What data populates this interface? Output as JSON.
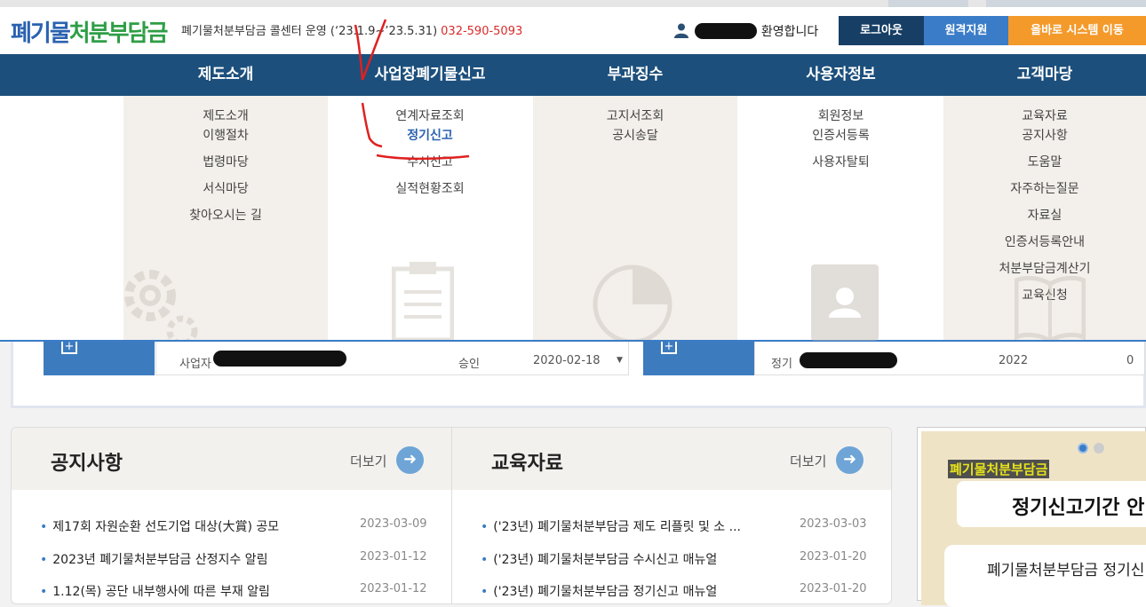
{
  "header": {
    "logo_part1": "폐기물",
    "logo_part2": "처분부담금",
    "callcenter": "폐기물처분부담금 콜센터 운영 (‘23.1.9~’23.5.31)",
    "phone": "032-590-5093",
    "welcome": "환영합니다",
    "buttons": [
      {
        "label": "로그아웃",
        "color": "#173f66"
      },
      {
        "label": "원격지원",
        "color": "#3a7cc7"
      },
      {
        "label": "올바로 시스템 이동",
        "color": "#f39a2b"
      }
    ]
  },
  "nav": {
    "items": [
      "제도소개",
      "사업장폐기물신고",
      "부과징수",
      "사용자정보",
      "고객마당"
    ]
  },
  "mega": {
    "col1": [
      "제도소개",
      "이행절차",
      "법령마당",
      "서식마당",
      "찾아오시는 길"
    ],
    "col2": [
      "연계자료조회",
      "정기신고",
      "수시신고",
      "실적현황조회"
    ],
    "col3": [
      "고지서조회",
      "공시송달"
    ],
    "col4": [
      "회원정보",
      "인증서등록",
      "사용자탈퇴"
    ],
    "col5": [
      "교육자료",
      "공지사항",
      "도움말",
      "자주하는질문",
      "자료실",
      "인증서등록안내",
      "처분부담금계산기",
      "교육신청"
    ],
    "active_item": "정기신고"
  },
  "behind": {
    "left": {
      "type": "사업자",
      "status": "승인",
      "date": "2020-02-18"
    },
    "right": {
      "type": "정기",
      "year": "2022",
      "value": "0"
    }
  },
  "boards": {
    "notice": {
      "title": "공지사항",
      "more": "더보기",
      "items": [
        {
          "title": "제17회 자원순환 선도기업 대상(大賞) 공모",
          "date": "2023-03-09"
        },
        {
          "title": "2023년 폐기물처분부담금 산정지수 알림",
          "date": "2023-01-12"
        },
        {
          "title": "1.12(목) 공단 내부행사에 따른 부재 알림",
          "date": "2023-01-12"
        }
      ]
    },
    "edu": {
      "title": "교육자료",
      "more": "더보기",
      "items": [
        {
          "title": "('23년) 폐기물처분부담금 제도 리플릿 및 소 ...",
          "date": "2023-03-03"
        },
        {
          "title": "('23년) 폐기물처분부담금 수시신고 매뉴얼",
          "date": "2023-01-20"
        },
        {
          "title": "('23년) 폐기물처분부담금 정기신고 매뉴얼",
          "date": "2023-01-20"
        }
      ]
    }
  },
  "banner": {
    "tag": "폐기물처분부담금",
    "line1": "정기신고기간 안",
    "line2": "폐기물처분부담금 정기신"
  },
  "colors": {
    "nav_bg": "#1c4f7c",
    "accent_blue": "#3a7cc7",
    "annotation_red": "#e02020"
  }
}
